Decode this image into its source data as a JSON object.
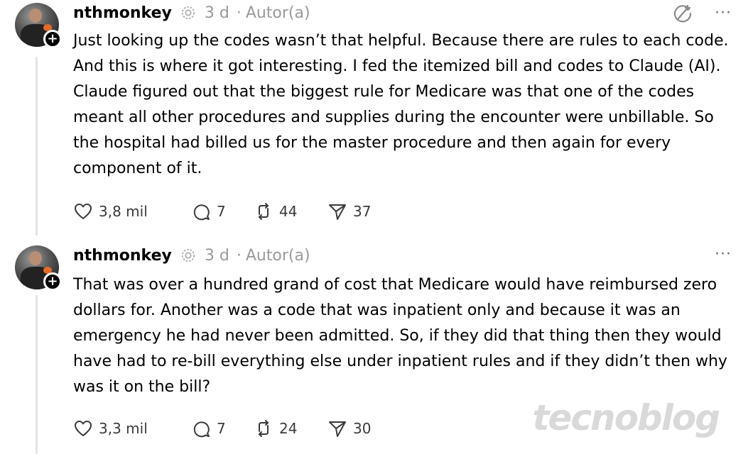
{
  "posts": [
    {
      "username": "nthmonkey",
      "time": "3 d",
      "separator": "·",
      "author_label": "Autor(a)",
      "follow_symbol": "+",
      "text": "Just looking up the codes wasn’t that helpful. Because there are rules to each code. And this is where it got interesting. I fed the itemized bill and codes to Claude (AI). Claude figured out that the biggest rule for Medicare was that one of the codes meant all other procedures and supplies during the encounter were unbillable. So the hospital had billed us for the master procedure and then again for every component of it.",
      "likes": "3,8 mil",
      "replies": "7",
      "reposts": "44",
      "shares": "37",
      "more": "···"
    },
    {
      "username": "nthmonkey",
      "time": "3 d",
      "separator": "·",
      "author_label": "Autor(a)",
      "follow_symbol": "+",
      "text": "That was over a hundred grand of cost that Medicare would have reimbursed zero dollars for. Another was a code that was inpatient only and because it was an emergency he had never been admitted. So, if they did that thing then they would have had to re-bill everything else under inpatient rules and if they didn’t then why was it on the bill?",
      "likes": "3,3 mil",
      "replies": "7",
      "reposts": "24",
      "shares": "30",
      "more": "···"
    }
  ],
  "watermark": "tecnoblog"
}
